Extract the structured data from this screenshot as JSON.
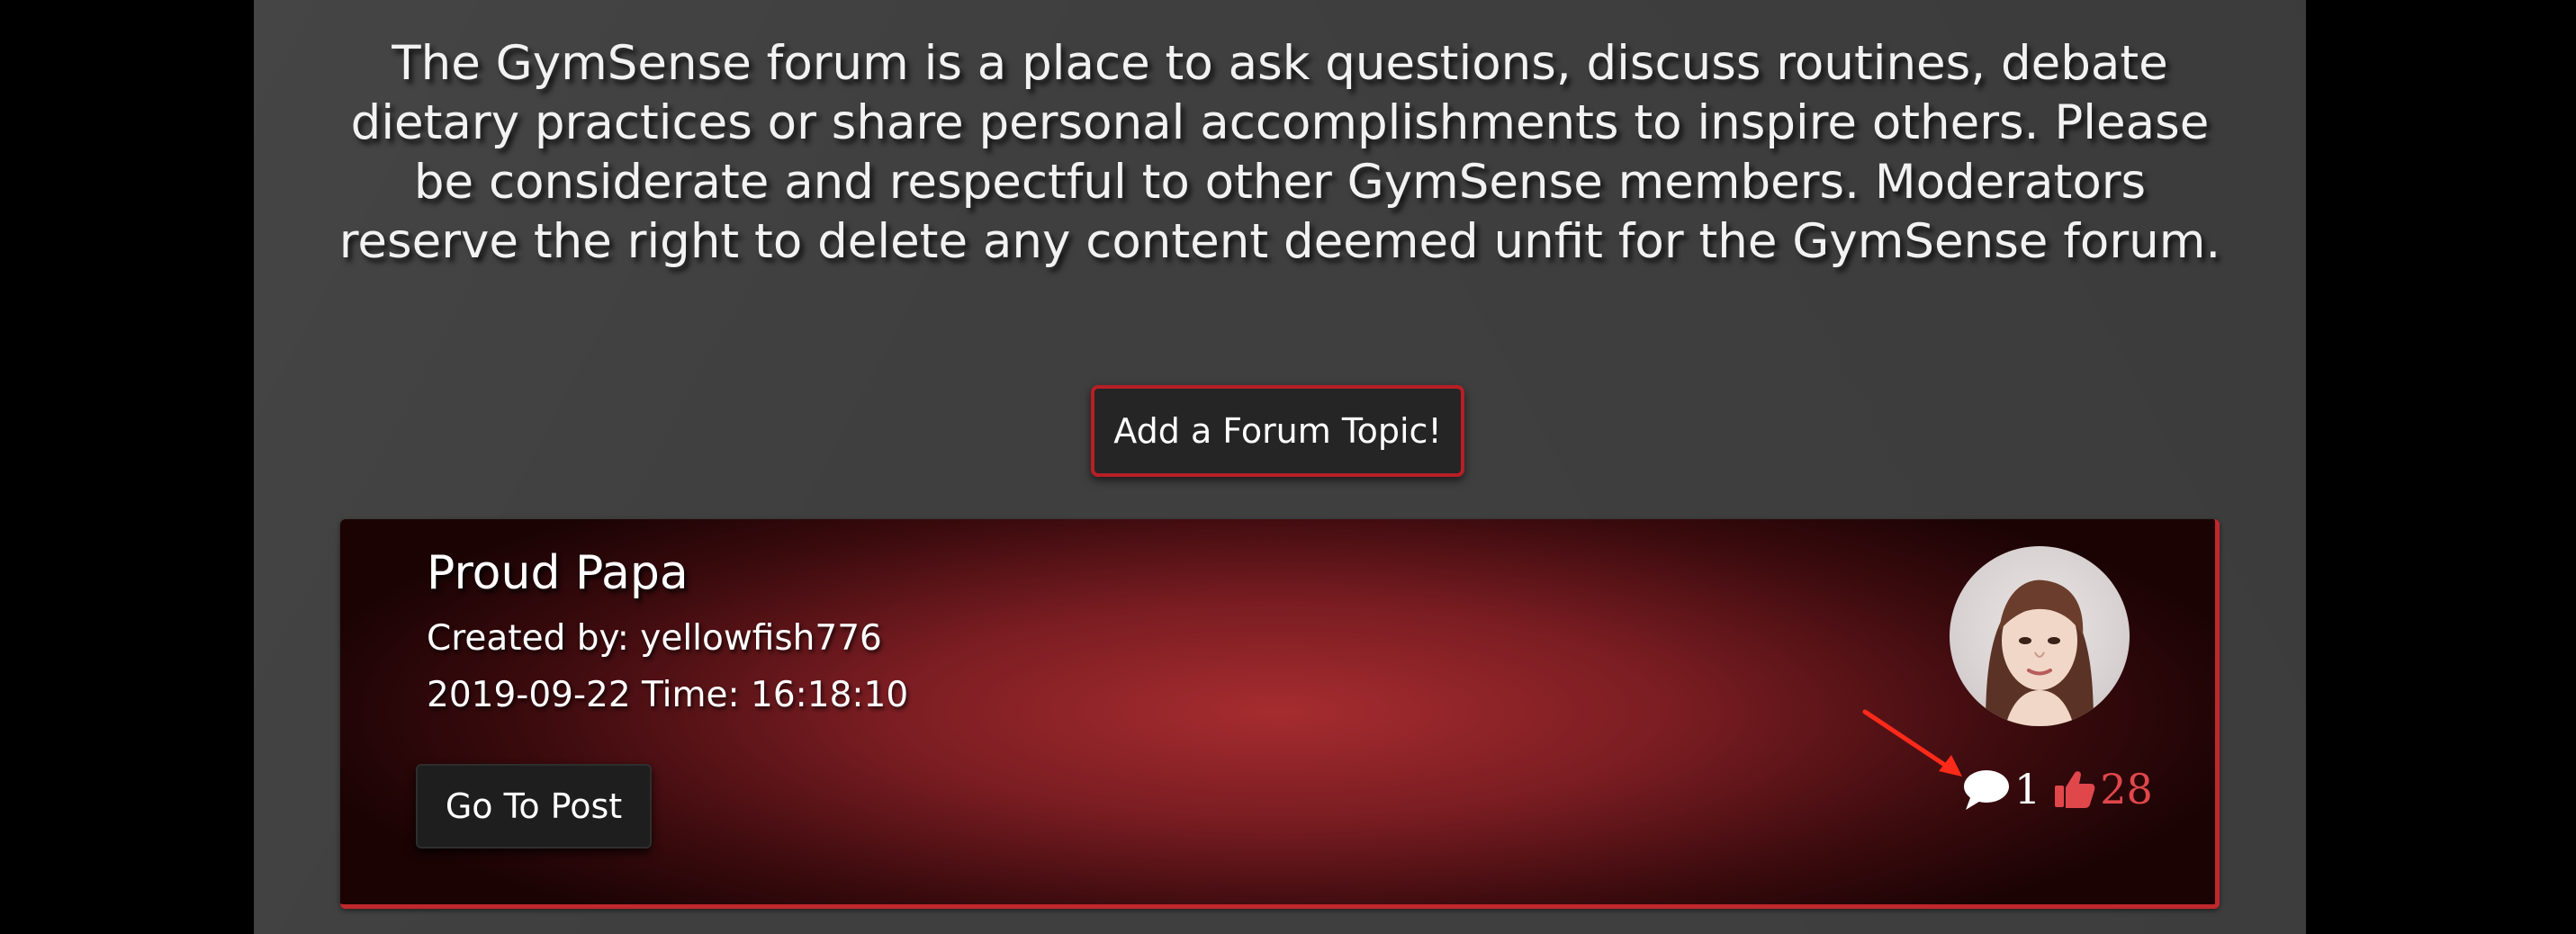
{
  "intro": {
    "text": "The GymSense forum is a place to ask questions, discuss routines, debate dietary practices or share personal accomplishments to inspire others. Please be considerate and respectful to other GymSense members. Moderators reserve the right to delete any content deemed unfit for the GymSense forum."
  },
  "add_topic_label": "Add a Forum Topic!",
  "post": {
    "title": "Proud Papa",
    "created_by": "Created by: yellowfish776",
    "datetime": "2019-09-22 Time: 16:18:10",
    "go_to_post_label": "Go To Post",
    "comment_count": "1",
    "like_count": "28",
    "avatar_icon": "user-avatar-photo",
    "comment_icon": "speech-bubble-icon",
    "like_icon": "thumbs-up-icon"
  },
  "colors": {
    "page_bg": "#000000",
    "panel_bg": "#3f3f3f",
    "accent_red": "#b71f25",
    "like_red": "#e0474b",
    "annotation_arrow": "#ff2a1a"
  }
}
